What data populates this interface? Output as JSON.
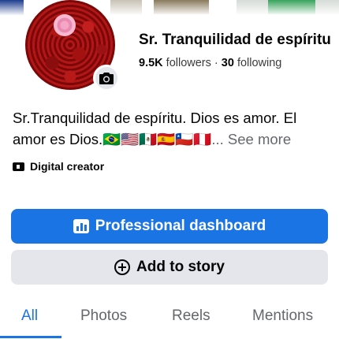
{
  "profile": {
    "name": "Sr. Tranquilidad de espíritu",
    "followers_count": "9.5K",
    "followers_label": "followers",
    "separator": " · ",
    "following_count": "30",
    "following_label": "following",
    "bio_text": "Sr.Tranquilidad de espíritu. Dios es amor. El amor es Dios.",
    "bio_flags": "🇧🇷🇺🇸🇲🇽🇪🇸🇨🇱🇵🇪",
    "bio_ellipsis": "...",
    "see_more": "See more",
    "category": "Digital creator",
    "camera_icon": "camera-icon"
  },
  "actions": {
    "professional_dashboard": "Professional dashboard",
    "add_to_story": "Add to story"
  },
  "tabs": [
    {
      "label": "All",
      "active": true
    },
    {
      "label": "Photos",
      "active": false
    },
    {
      "label": "Reels",
      "active": false
    },
    {
      "label": "Mentions",
      "active": false
    }
  ],
  "colors": {
    "accent": "#1b74e4",
    "secondary_button": "#e4e6eb",
    "muted_text": "#65676b"
  }
}
